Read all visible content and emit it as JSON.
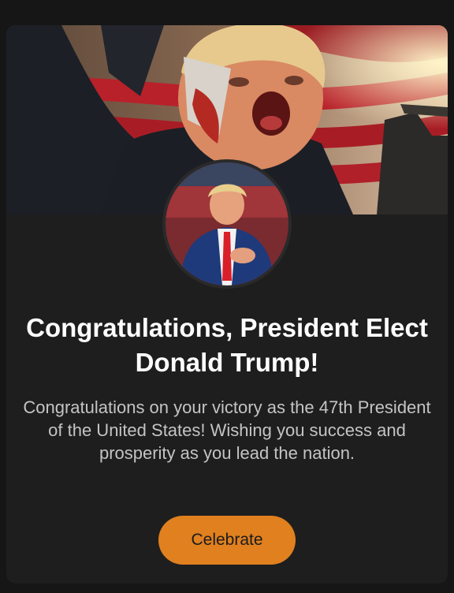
{
  "card": {
    "banner_image": "fighting-stance-banner-image",
    "avatar_image": "president-elect-portrait",
    "title": "Congratulations, President Elect Donald Trump!",
    "message": "Congratulations on your victory as the 47th President of the United States! Wishing you success and prosperity as you lead the nation.",
    "button_label": "Celebrate"
  },
  "colors": {
    "page_background": "#161616",
    "card_background": "#1e1e1e",
    "title_text": "#ffffff",
    "message_text": "#c4c4c4",
    "button_background": "#e0801f",
    "button_text": "#1b1b1b"
  }
}
